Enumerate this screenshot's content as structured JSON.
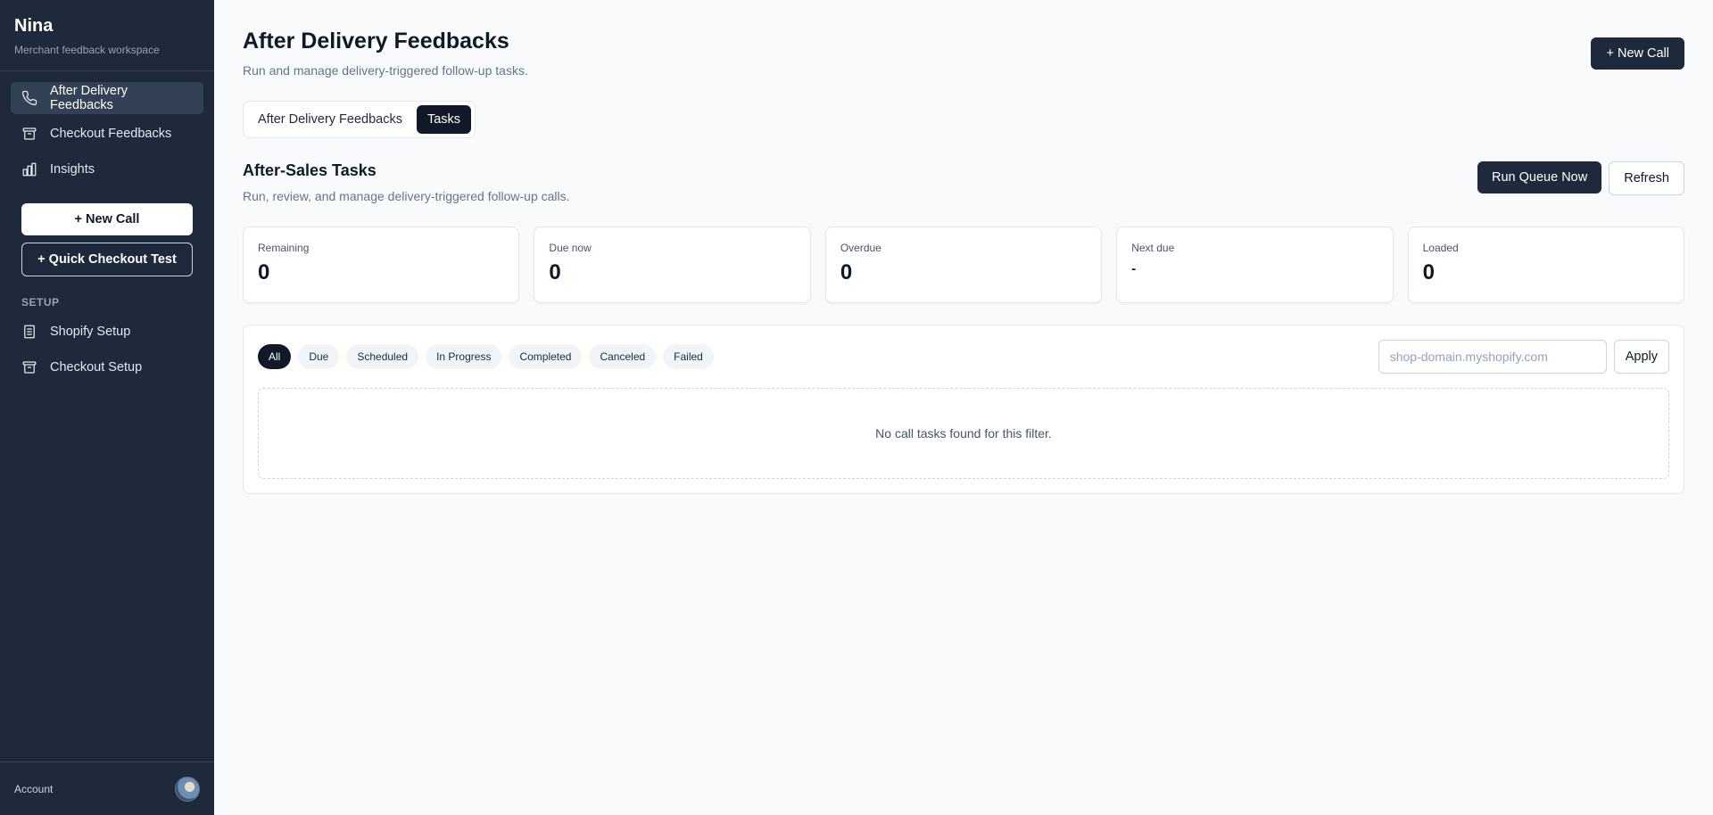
{
  "sidebar": {
    "brand": "Nina",
    "subtitle": "Merchant feedback workspace",
    "nav": [
      {
        "label": "After Delivery Feedbacks",
        "icon": "phone-icon",
        "active": true
      },
      {
        "label": "Checkout Feedbacks",
        "icon": "archive-icon",
        "active": false
      },
      {
        "label": "Insights",
        "icon": "bar-chart-icon",
        "active": false
      }
    ],
    "new_call_label": "+ New Call",
    "quick_checkout_label": "+ Quick Checkout Test",
    "setup_label": "SETUP",
    "setup_items": [
      {
        "label": "Shopify Setup",
        "icon": "document-icon"
      },
      {
        "label": "Checkout Setup",
        "icon": "archive-icon"
      }
    ],
    "account_label": "Account"
  },
  "header": {
    "title": "After Delivery Feedbacks",
    "subtitle": "Run and manage delivery-triggered follow-up tasks.",
    "new_call_label": "+ New Call"
  },
  "tabs": [
    {
      "label": "After Delivery Feedbacks",
      "active": false
    },
    {
      "label": "Tasks",
      "active": true
    }
  ],
  "section": {
    "title": "After-Sales Tasks",
    "subtitle": "Run, review, and manage delivery-triggered follow-up calls.",
    "run_label": "Run Queue Now",
    "refresh_label": "Refresh"
  },
  "stats": [
    {
      "label": "Remaining",
      "value": "0"
    },
    {
      "label": "Due now",
      "value": "0"
    },
    {
      "label": "Overdue",
      "value": "0"
    },
    {
      "label": "Next due",
      "value": "-"
    },
    {
      "label": "Loaded",
      "value": "0"
    }
  ],
  "filters": {
    "chips": [
      "All",
      "Due",
      "Scheduled",
      "In Progress",
      "Completed",
      "Canceled",
      "Failed"
    ],
    "active_chip": "All",
    "domain_placeholder": "shop-domain.myshopify.com",
    "domain_value": "",
    "apply_label": "Apply"
  },
  "empty_message": "No call tasks found for this filter.",
  "colors": {
    "sidebar_bg": "#1e293b",
    "primary_dark": "#111827",
    "page_bg": "#f8fafc"
  }
}
